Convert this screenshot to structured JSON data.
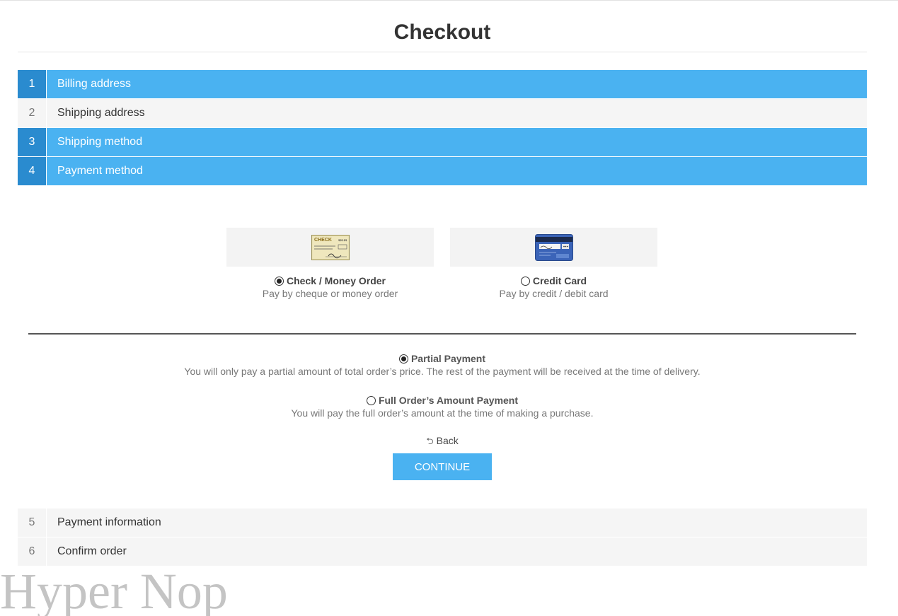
{
  "page": {
    "title": "Checkout"
  },
  "steps_top": [
    {
      "number": "1",
      "label": "Billing address",
      "state": "active"
    },
    {
      "number": "2",
      "label": "Shipping address",
      "state": "inactive"
    },
    {
      "number": "3",
      "label": "Shipping method",
      "state": "active"
    },
    {
      "number": "4",
      "label": "Payment method",
      "state": "active"
    }
  ],
  "steps_bottom": [
    {
      "number": "5",
      "label": "Payment information",
      "state": "inactive"
    },
    {
      "number": "6",
      "label": "Confirm order",
      "state": "inactive"
    }
  ],
  "payment_methods": [
    {
      "name": "Check / Money Order",
      "description": "Pay by cheque or money order",
      "selected": true,
      "icon": "check-image"
    },
    {
      "name": "Credit Card",
      "description": "Pay by credit / debit card",
      "selected": false,
      "icon": "credit-card-image"
    }
  ],
  "check_image": {
    "word": "CHECK",
    "amount": "$$$.$$"
  },
  "payment_options": [
    {
      "name": "Partial Payment",
      "description": "You will only pay a partial amount of total order’s price. The rest of the payment will be received at the time of delivery.",
      "selected": true
    },
    {
      "name": "Full Order’s Amount Payment",
      "description": "You will pay the full order’s amount at the time of making a purchase.",
      "selected": false
    }
  ],
  "actions": {
    "back_label": "Back",
    "continue_label": "CONTINUE"
  },
  "watermark": "Hyper Nop",
  "colors": {
    "accent": "#4ab2f1",
    "accent_dark": "#2a8bcf",
    "inactive_bg": "#f5f5f5"
  }
}
